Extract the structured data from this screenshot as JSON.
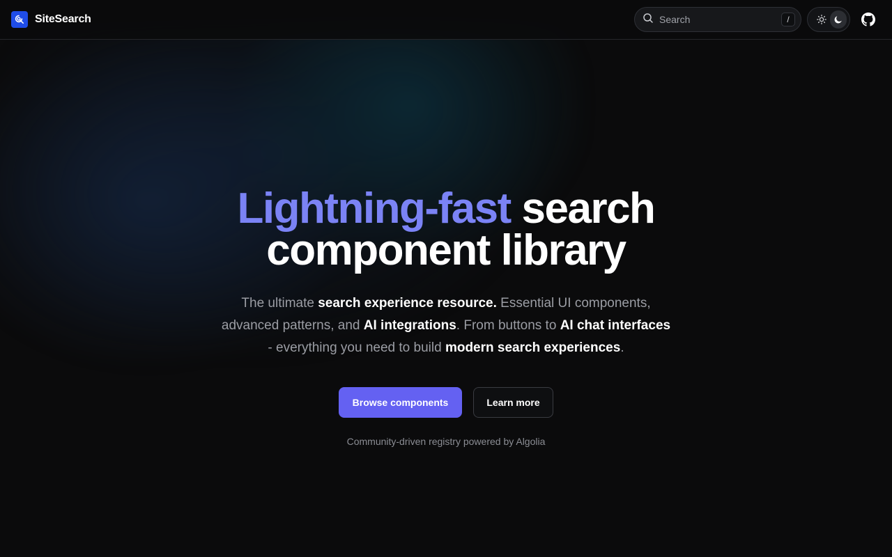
{
  "header": {
    "brand": "SiteSearch",
    "search_placeholder": "Search",
    "search_shortcut": "/",
    "theme_options": [
      "light",
      "dark"
    ],
    "theme_selected": "dark",
    "github_icon": "github-icon"
  },
  "hero": {
    "headline_accent": "Lightning-fast",
    "headline_line1_rest": " search",
    "headline_line2": "component library",
    "subtitle": {
      "t1": "The ultimate ",
      "b1": "search experience resource.",
      "t2": " Essential UI components, advanced patterns, and ",
      "b2": "AI integrations",
      "t3": ". From buttons to ",
      "b3": "AI chat interfaces",
      "t4": " - everything you need to build ",
      "b4": "modern search experiences",
      "t5": "."
    },
    "primary_button": "Browse components",
    "secondary_button": "Learn more",
    "footnote": "Community-driven registry powered by Algolia"
  },
  "colors": {
    "background": "#0b0b0c",
    "accent": "#7b83f5",
    "primary_button": "#6461f2",
    "logo": "#1f4de8"
  }
}
